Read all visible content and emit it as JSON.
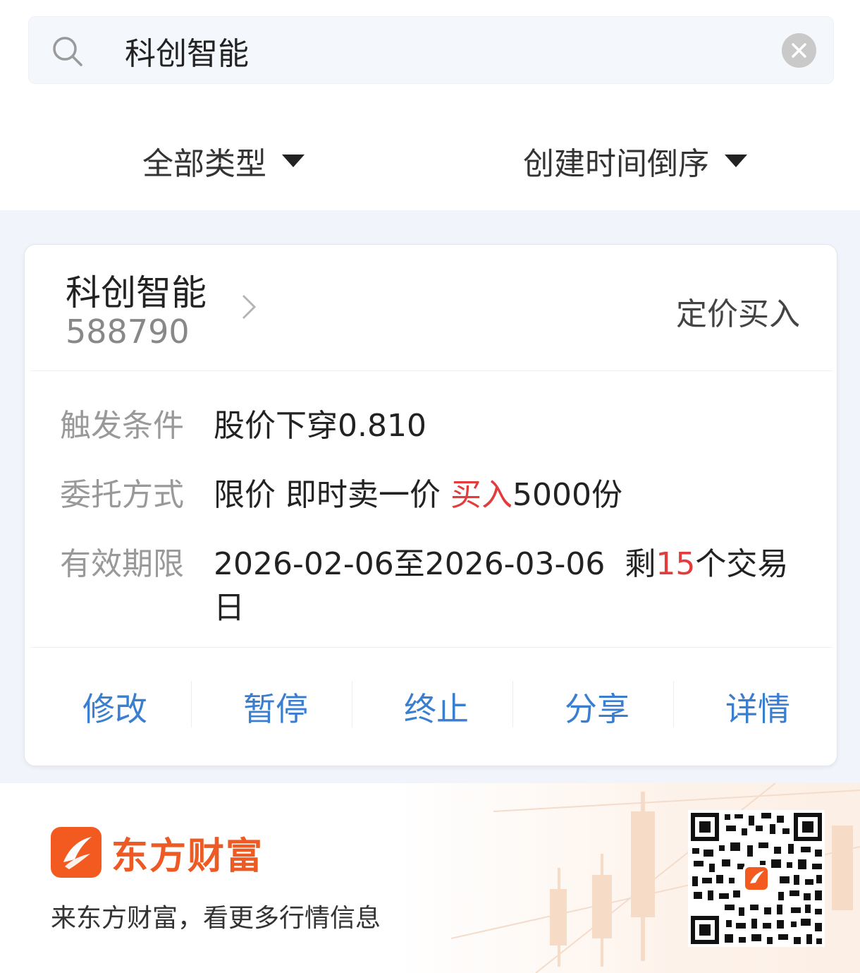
{
  "search": {
    "value": "科创智能"
  },
  "filters": {
    "type_label": "全部类型",
    "sort_label": "创建时间倒序"
  },
  "order": {
    "stock_name": "科创智能",
    "stock_code": "588790",
    "order_type": "定价买入",
    "trigger_label": "触发条件",
    "trigger_value": "股价下穿0.810",
    "method_label": "委托方式",
    "method_prefix": "限价 即时卖一价 ",
    "method_action": "买入",
    "method_suffix": "5000份",
    "validity_label": "有效期限",
    "validity_range": "2026-02-06至2026-03-06",
    "validity_remaining_prefix": "剩",
    "validity_remaining_days": "15",
    "validity_remaining_suffix": "个交易",
    "validity_remaining_suffix2": "日"
  },
  "actions": [
    {
      "label": "修改"
    },
    {
      "label": "暂停"
    },
    {
      "label": "终止"
    },
    {
      "label": "分享"
    },
    {
      "label": "详情"
    }
  ],
  "footer": {
    "brand": "东方财富",
    "slogan": "来东方财富，看更多行情信息"
  },
  "colors": {
    "accent_blue": "#3a7ed0",
    "highlight_red": "#e23c3c",
    "brand_orange": "#f25a1f",
    "list_bg": "#f1f5fb"
  },
  "icons": [
    "search-icon",
    "clear-icon",
    "caret-down-icon",
    "chevron-right-icon",
    "brand-logo-icon",
    "qr-code"
  ]
}
